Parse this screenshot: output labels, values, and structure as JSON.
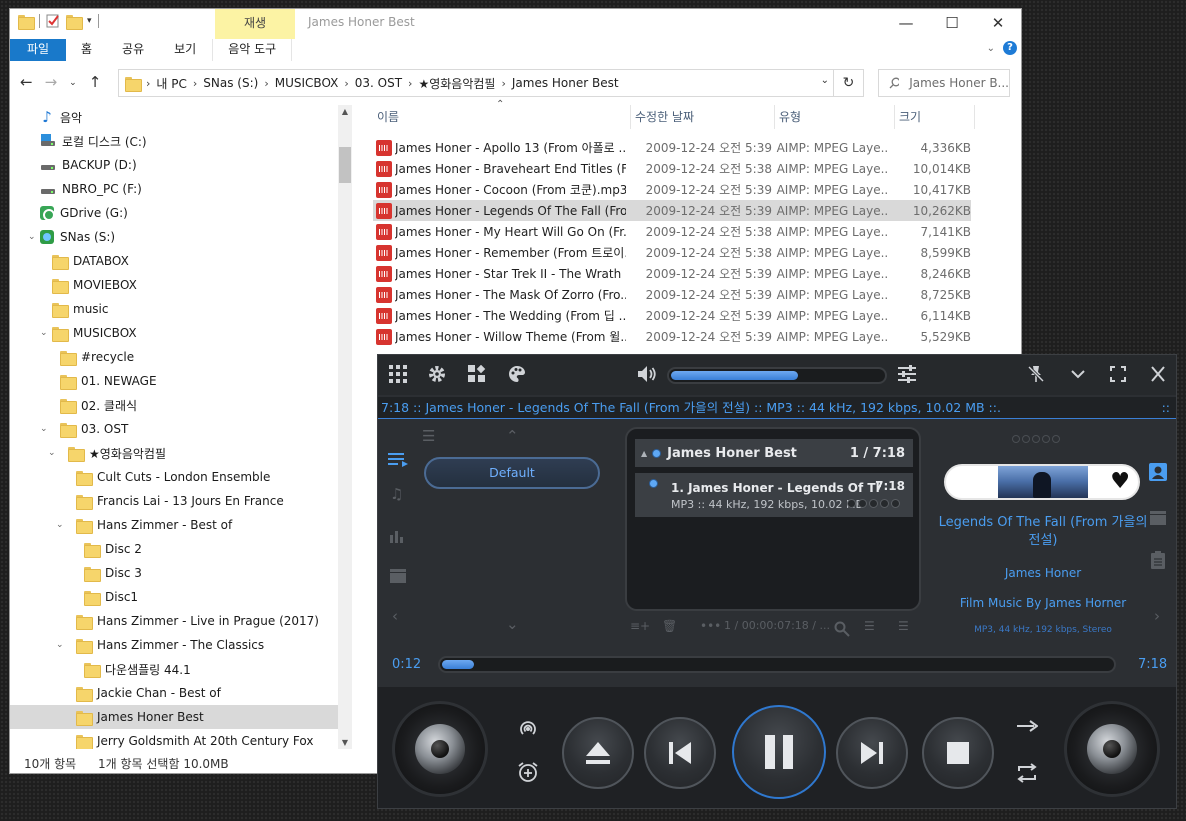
{
  "explorer": {
    "title": "James Honer Best",
    "context_tab": "재생",
    "ribbon_tabs": [
      "파일",
      "홈",
      "공유",
      "보기",
      "음악 도구"
    ],
    "window_controls": [
      "minimize-icon",
      "maximize-icon",
      "close-icon"
    ],
    "address": {
      "crumbs": [
        "내 PC",
        "SNas (S:)",
        "MUSICBOX",
        "03. OST",
        "★영화음악컴필",
        "James Honer Best"
      ]
    },
    "search": {
      "placeholder": "James Honer B..."
    },
    "nav": [
      {
        "label": "음악",
        "icon": "music-note-icon"
      },
      {
        "label": "로컬 디스크 (C:)",
        "icon": "system-drive-icon"
      },
      {
        "label": "BACKUP (D:)",
        "icon": "drive-icon"
      },
      {
        "label": "NBRO_PC (F:)",
        "icon": "drive-icon"
      },
      {
        "label": "GDrive (G:)",
        "icon": "gdrive-icon"
      },
      {
        "label": "SNas (S:)",
        "icon": "network-drive-icon"
      },
      {
        "label": "DATABOX",
        "icon": "folder-icon"
      },
      {
        "label": "MOVIEBOX",
        "icon": "folder-icon"
      },
      {
        "label": "music",
        "icon": "folder-icon"
      },
      {
        "label": "MUSICBOX",
        "icon": "folder-icon"
      },
      {
        "label": "#recycle",
        "icon": "folder-icon"
      },
      {
        "label": "01. NEWAGE",
        "icon": "folder-icon"
      },
      {
        "label": "02. 클래식",
        "icon": "folder-icon"
      },
      {
        "label": "03. OST",
        "icon": "folder-icon"
      },
      {
        "label": "★영화음악컴필",
        "icon": "folder-icon"
      },
      {
        "label": "Cult Cuts - London Ensemble",
        "icon": "folder-icon"
      },
      {
        "label": "Francis Lai - 13 Jours En France",
        "icon": "folder-icon"
      },
      {
        "label": "Hans Zimmer - Best of",
        "icon": "folder-icon"
      },
      {
        "label": "Disc 2",
        "icon": "folder-icon"
      },
      {
        "label": "Disc 3",
        "icon": "folder-icon"
      },
      {
        "label": "Disc1",
        "icon": "folder-icon"
      },
      {
        "label": "Hans Zimmer - Live in Prague (2017)",
        "icon": "folder-icon"
      },
      {
        "label": "Hans Zimmer - The Classics",
        "icon": "folder-icon"
      },
      {
        "label": "다운샘플링 44.1",
        "icon": "folder-icon"
      },
      {
        "label": "Jackie Chan - Best of",
        "icon": "folder-icon"
      },
      {
        "label": "James Honer Best",
        "icon": "folder-icon",
        "selected": true
      },
      {
        "label": "Jerry Goldsmith At 20th Century Fox",
        "icon": "folder-icon"
      }
    ],
    "columns": [
      "이름",
      "수정한 날짜",
      "유형",
      "크기"
    ],
    "files": [
      {
        "name": "James Honer - Apollo 13 (From 아폴로 ...",
        "date": "2009-12-24 오전 5:39",
        "type": "AIMP: MPEG Laye...",
        "size": "4,336KB"
      },
      {
        "name": "James Honer - Braveheart End Titles (Fr...",
        "date": "2009-12-24 오전 5:38",
        "type": "AIMP: MPEG Laye...",
        "size": "10,014KB"
      },
      {
        "name": "James Honer - Cocoon (From 코쿤).mp3",
        "date": "2009-12-24 오전 5:39",
        "type": "AIMP: MPEG Laye...",
        "size": "10,417KB"
      },
      {
        "name": "James Honer - Legends Of The Fall (Fro...",
        "date": "2009-12-24 오전 5:39",
        "type": "AIMP: MPEG Laye...",
        "size": "10,262KB",
        "selected": true
      },
      {
        "name": "James Honer - My Heart Will Go On (Fr...",
        "date": "2009-12-24 오전 5:38",
        "type": "AIMP: MPEG Laye...",
        "size": "7,141KB"
      },
      {
        "name": "James Honer - Remember (From 트로이...",
        "date": "2009-12-24 오전 5:38",
        "type": "AIMP: MPEG Laye...",
        "size": "8,599KB"
      },
      {
        "name": "James Honer - Star Trek II - The Wrath ...",
        "date": "2009-12-24 오전 5:39",
        "type": "AIMP: MPEG Laye...",
        "size": "8,246KB"
      },
      {
        "name": "James Honer - The Mask Of Zorro (Fro...",
        "date": "2009-12-24 오전 5:39",
        "type": "AIMP: MPEG Laye...",
        "size": "8,725KB"
      },
      {
        "name": "James Honer - The Wedding (From 딥 ...",
        "date": "2009-12-24 오전 5:39",
        "type": "AIMP: MPEG Laye...",
        "size": "6,114KB"
      },
      {
        "name": "James Honer - Willow Theme (From 윌...",
        "date": "2009-12-24 오전 5:39",
        "type": "AIMP: MPEG Laye...",
        "size": "5,529KB"
      }
    ],
    "status": {
      "count": "10개 항목",
      "selection": "1개 항목 선택함 10.0MB"
    }
  },
  "player": {
    "volume": 0.6,
    "ticker": "7:18 :: James Honer - Legends Of The Fall (From 가을의 전설) :: MP3 :: 44 kHz, 192 kbps, 10.02 MB ::.",
    "ticker_end": "::",
    "preset": "Default",
    "playlist": {
      "title": "James Honer Best",
      "count": "1 / 7:18",
      "entry_title": "1. James Honer - Legends Of The Fall (From 가을의 전설)",
      "entry_duration": "7:18",
      "entry_info": "MP3 :: 44 kHz, 192 kbps, 10.02 MB",
      "toolbar_status": "1 / 00:00:07:18 / ..."
    },
    "track": {
      "title": "Legends Of The Fall (From 가을의 전설)",
      "artist": "James Honer",
      "album": "Film Music By James Horner",
      "format": "MP3, 44 kHz, 192 kbps, Stereo"
    },
    "elapsed": "0:12",
    "duration": "7:18",
    "progress": 0.027,
    "accent": "#4a9df0"
  }
}
